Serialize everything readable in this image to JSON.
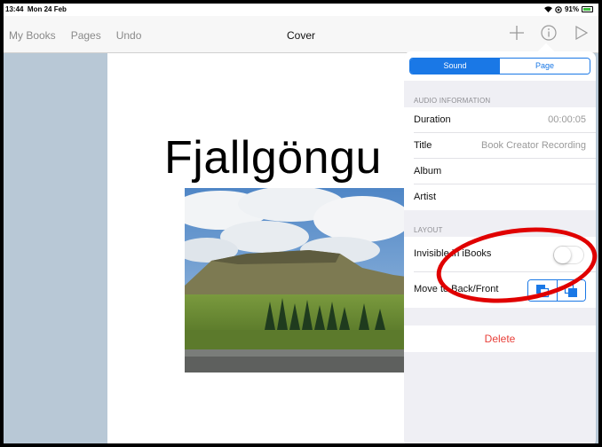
{
  "status_bar": {
    "time": "13:44",
    "date": "Mon 24 Feb",
    "battery": "91%",
    "battery_level": 0.91
  },
  "nav": {
    "items": [
      "My Books",
      "Pages",
      "Undo"
    ],
    "title": "Cover",
    "icons": [
      "plus-icon",
      "info-icon",
      "play-icon"
    ]
  },
  "page": {
    "title": "Fjallgöngu"
  },
  "inspector": {
    "segments": [
      "Sound",
      "Page"
    ],
    "active_segment": "Sound",
    "audio_header": "AUDIO INFORMATION",
    "audio_rows": [
      {
        "label": "Duration",
        "value": "00:00:05"
      },
      {
        "label": "Title",
        "value": "Book Creator Recording"
      },
      {
        "label": "Album",
        "value": ""
      },
      {
        "label": "Artist",
        "value": ""
      }
    ],
    "layout_header": "LAYOUT",
    "invisible_label": "Invisible in iBooks",
    "invisible_on": false,
    "move_label": "Move to Back/Front",
    "move_buttons": [
      "send-to-back-icon",
      "bring-to-front-icon"
    ],
    "delete_label": "Delete"
  },
  "colors": {
    "accent": "#1a78e6",
    "destructive": "#e8403a",
    "annotation": "#e00000",
    "background": "#b8c8d6"
  }
}
